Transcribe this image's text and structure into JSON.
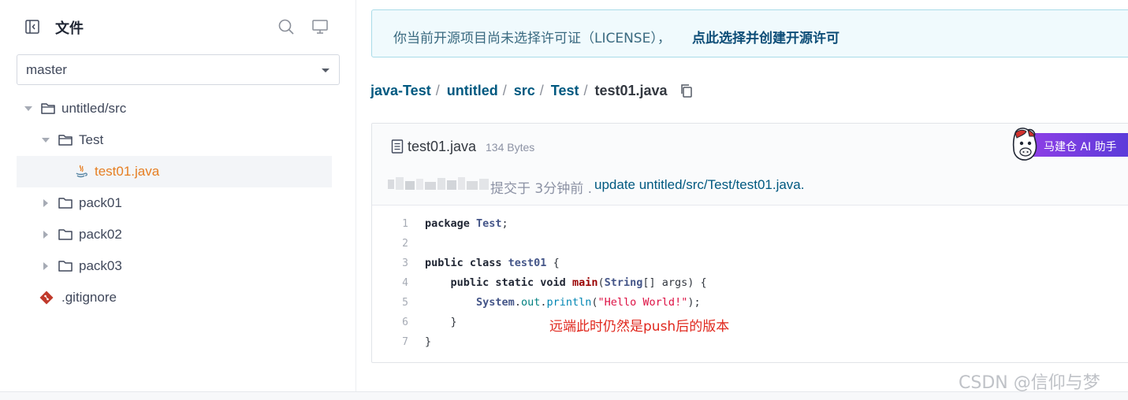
{
  "sidebar": {
    "title": "文件",
    "branch": "master",
    "tree": [
      {
        "label": "untitled/src",
        "type": "folder",
        "expanded": true
      },
      {
        "label": "Test",
        "type": "folder",
        "expanded": true
      },
      {
        "label": "test01.java",
        "type": "java-file",
        "selected": true
      },
      {
        "label": "pack01",
        "type": "folder",
        "expanded": false
      },
      {
        "label": "pack02",
        "type": "folder",
        "expanded": false
      },
      {
        "label": "pack03",
        "type": "folder",
        "expanded": false
      },
      {
        "label": ".gitignore",
        "type": "git-file"
      }
    ]
  },
  "notice": {
    "text": "你当前开源项目尚未选择许可证（LICENSE），",
    "link": "点此选择并创建开源许可"
  },
  "breadcrumb": [
    "java-Test",
    "untitled",
    "src",
    "Test",
    "test01.java"
  ],
  "file": {
    "name": "test01.java",
    "size": "134 Bytes",
    "commit_text": "提交于 3分钟前 .",
    "commit_message": "update untitled/src/Test/test01.java.",
    "ai_badge": "马建仓 AI 助手"
  },
  "code": {
    "line_numbers": [
      "1",
      "2",
      "3",
      "4",
      "5",
      "6",
      "7"
    ],
    "lines": [
      [
        {
          "t": "package ",
          "c": "kw"
        },
        {
          "t": "Test",
          "c": "ty"
        },
        {
          "t": ";",
          "c": ""
        }
      ],
      [],
      [
        {
          "t": "public class ",
          "c": "kw"
        },
        {
          "t": "test01",
          "c": "ty"
        },
        {
          "t": " {",
          "c": ""
        }
      ],
      [
        {
          "t": "    public static void ",
          "c": "kw"
        },
        {
          "t": "main",
          "c": "fn"
        },
        {
          "t": "(",
          "c": ""
        },
        {
          "t": "String",
          "c": "ty"
        },
        {
          "t": "[] args) {",
          "c": ""
        }
      ],
      [
        {
          "t": "        ",
          "c": ""
        },
        {
          "t": "System",
          "c": "ty"
        },
        {
          "t": ".",
          "c": ""
        },
        {
          "t": "out",
          "c": "id"
        },
        {
          "t": ".",
          "c": ""
        },
        {
          "t": "println",
          "c": "me"
        },
        {
          "t": "(",
          "c": ""
        },
        {
          "t": "\"Hello World!\"",
          "c": "st"
        },
        {
          "t": ");",
          "c": ""
        }
      ],
      [
        {
          "t": "    }",
          "c": ""
        }
      ],
      [
        {
          "t": "}",
          "c": ""
        }
      ]
    ]
  },
  "annotation": "远端此时仍然是push后的版本",
  "watermark": "CSDN @信仰与梦",
  "colors": {
    "accent": "#005980",
    "active_file": "#e67e22",
    "annotation": "#e0271d"
  }
}
